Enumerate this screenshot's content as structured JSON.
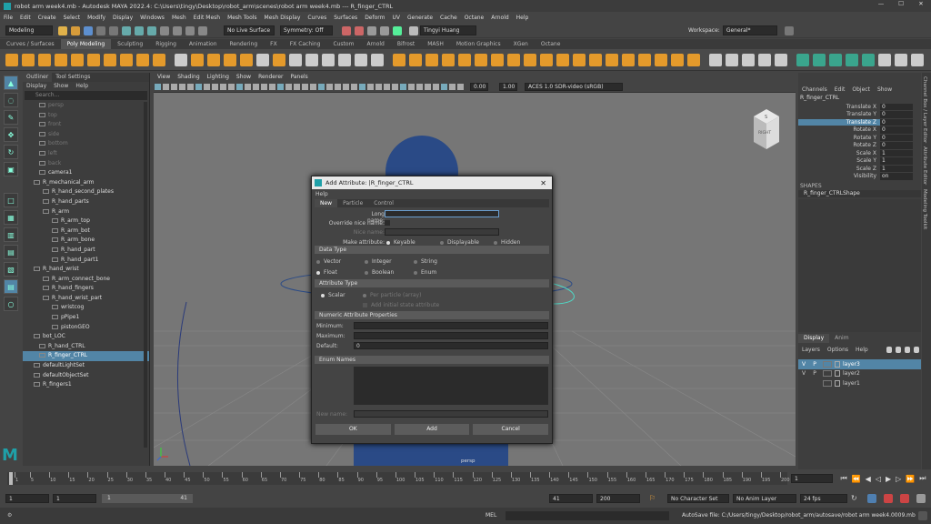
{
  "titlebar": {
    "title": "robot arm week4.mb - Autodesk MAYA 2022.4: C:\\Users\\tingy\\Desktop\\robot_arm\\scenes\\robot arm week4.mb --- R_finger_CTRL",
    "min": "—",
    "max": "☐",
    "close": "✕"
  },
  "menus": [
    "File",
    "Edit",
    "Create",
    "Select",
    "Modify",
    "Display",
    "Windows",
    "Mesh",
    "Edit Mesh",
    "Mesh Tools",
    "Mesh Display",
    "Curves",
    "Surfaces",
    "Deform",
    "UV",
    "Generate",
    "Cache",
    "Octane",
    "Arnold",
    "Help"
  ],
  "workspace": {
    "label": "Workspace:",
    "value": "General*"
  },
  "status": {
    "mode": "Modeling",
    "live": "No Live Surface",
    "symmetry": "Symmetry: Off",
    "user": "Tingyi Huang"
  },
  "shelf_tabs": [
    "Curves / Surfaces",
    "Poly Modeling",
    "Sculpting",
    "Rigging",
    "Animation",
    "Rendering",
    "FX",
    "FX Caching",
    "Custom",
    "Arnold",
    "Bifrost",
    "MASH",
    "Motion Graphics",
    "XGen",
    "Octane"
  ],
  "shelf_active": "Poly Modeling",
  "outliner": {
    "tabs": [
      "Outliner",
      "Tool Settings"
    ],
    "menu": [
      "Display",
      "Show",
      "Help"
    ],
    "search": "Search...",
    "items": [
      {
        "label": "persp",
        "indent": 18,
        "dim": true,
        "sel": false
      },
      {
        "label": "top",
        "indent": 18,
        "dim": true,
        "sel": false
      },
      {
        "label": "front",
        "indent": 18,
        "dim": true,
        "sel": false
      },
      {
        "label": "side",
        "indent": 18,
        "dim": true,
        "sel": false
      },
      {
        "label": "bottom",
        "indent": 18,
        "dim": true,
        "sel": false
      },
      {
        "label": "left",
        "indent": 18,
        "dim": true,
        "sel": false
      },
      {
        "label": "back",
        "indent": 18,
        "dim": true,
        "sel": false
      },
      {
        "label": "camera1",
        "indent": 18,
        "dim": false,
        "sel": false
      },
      {
        "label": "R_mechanical_arm",
        "indent": 12,
        "dim": false,
        "sel": false
      },
      {
        "label": "R_hand_second_plates",
        "indent": 22,
        "dim": false,
        "sel": false
      },
      {
        "label": "R_hand_parts",
        "indent": 22,
        "dim": false,
        "sel": false
      },
      {
        "label": "R_arm",
        "indent": 22,
        "dim": false,
        "sel": false
      },
      {
        "label": "R_arm_top",
        "indent": 32,
        "dim": false,
        "sel": false
      },
      {
        "label": "R_arm_bot",
        "indent": 32,
        "dim": false,
        "sel": false
      },
      {
        "label": "R_arm_bone",
        "indent": 32,
        "dim": false,
        "sel": false
      },
      {
        "label": "R_hand_part",
        "indent": 32,
        "dim": false,
        "sel": false
      },
      {
        "label": "R_hand_part1",
        "indent": 32,
        "dim": false,
        "sel": false
      },
      {
        "label": "R_hand_wrist",
        "indent": 12,
        "dim": false,
        "sel": false
      },
      {
        "label": "R_arm_connect_bone",
        "indent": 22,
        "dim": false,
        "sel": false
      },
      {
        "label": "R_hand_fingers",
        "indent": 22,
        "dim": false,
        "sel": false
      },
      {
        "label": "R_hand_wrist_part",
        "indent": 22,
        "dim": false,
        "sel": false
      },
      {
        "label": "wristcog",
        "indent": 32,
        "dim": false,
        "sel": false
      },
      {
        "label": "pPipe1",
        "indent": 32,
        "dim": false,
        "sel": false
      },
      {
        "label": "pistonGEO",
        "indent": 32,
        "dim": false,
        "sel": false
      },
      {
        "label": "bot_LOC",
        "indent": 12,
        "dim": false,
        "sel": false
      },
      {
        "label": "R_hand_CTRL",
        "indent": 18,
        "dim": false,
        "sel": false
      },
      {
        "label": "R_finger_CTRL",
        "indent": 18,
        "dim": false,
        "sel": true
      },
      {
        "label": "defaultLightSet",
        "indent": 12,
        "dim": false,
        "sel": false
      },
      {
        "label": "defaultObjectSet",
        "indent": 12,
        "dim": false,
        "sel": false
      },
      {
        "label": "R_fingers1",
        "indent": 12,
        "dim": false,
        "sel": false
      }
    ]
  },
  "viewport": {
    "menu": [
      "View",
      "Shading",
      "Lighting",
      "Show",
      "Renderer",
      "Panels"
    ],
    "exposure": "0.00",
    "gamma": "1.00",
    "colorspace": "ACES 1.0 SDR-video (sRGB)",
    "camera_label": "persp",
    "cube_top": "S",
    "cube_face": "RIGHT"
  },
  "dialog": {
    "title": "Add Attribute: |R_finger_CTRL",
    "menu": "Help",
    "tabs": [
      "New",
      "Particle",
      "Control"
    ],
    "long_name_label": "Long name:",
    "long_name_value": "",
    "override_label": "Override nice name:",
    "nice_name_label": "Nice name:",
    "make_attr_label": "Make attribute:",
    "make_attr": [
      "Keyable",
      "Displayable",
      "Hidden"
    ],
    "data_type_hdr": "Data Type",
    "data_types": [
      "Vector",
      "Integer",
      "String",
      "Float",
      "Boolean",
      "Enum"
    ],
    "attr_type_hdr": "Attribute Type",
    "attr_scalar": "Scalar",
    "attr_particle": "Per particle (array)",
    "attr_initial": "Add initial state attribute",
    "numeric_hdr": "Numeric Attribute Properties",
    "min_label": "Minimum:",
    "max_label": "Maximum:",
    "default_label": "Default:",
    "default_value": "0",
    "enum_hdr": "Enum Names",
    "new_name_label": "New name:",
    "ok": "OK",
    "add": "Add",
    "cancel": "Cancel"
  },
  "channel_box": {
    "menu": [
      "Channels",
      "Edit",
      "Object",
      "Show"
    ],
    "object": "R_finger_CTRL",
    "channels": [
      {
        "k": "Translate X",
        "v": "0"
      },
      {
        "k": "Translate Y",
        "v": "0"
      },
      {
        "k": "Translate Z",
        "v": "0"
      },
      {
        "k": "Rotate X",
        "v": "0"
      },
      {
        "k": "Rotate Y",
        "v": "0"
      },
      {
        "k": "Rotate Z",
        "v": "0"
      },
      {
        "k": "Scale X",
        "v": "1"
      },
      {
        "k": "Scale Y",
        "v": "1"
      },
      {
        "k": "Scale Z",
        "v": "1"
      },
      {
        "k": "Visibility",
        "v": "on"
      }
    ],
    "highlight": "Translate Z",
    "shapes_hdr": "SHAPES",
    "shape": "R_finger_CTRLShape"
  },
  "layers": {
    "tabs": [
      "Display",
      "Anim"
    ],
    "menu": [
      "Layers",
      "Options",
      "Help"
    ],
    "rows": [
      {
        "v": "V",
        "p": "P",
        "name": "layer3",
        "sel": true
      },
      {
        "v": "V",
        "p": "P",
        "name": "layer2",
        "sel": false
      },
      {
        "v": "",
        "p": "",
        "name": "layer1",
        "sel": false
      }
    ]
  },
  "side_tabs": [
    "Channel Box / Layer Editor",
    "Attribute Editor",
    "Modeling Toolkit"
  ],
  "timeline": {
    "ticks": [
      "1",
      "5",
      "10",
      "15",
      "20",
      "25",
      "30",
      "35",
      "40",
      "45",
      "50",
      "55",
      "60",
      "65",
      "70",
      "75",
      "80",
      "85",
      "90",
      "95",
      "100",
      "105",
      "110",
      "115",
      "120",
      "125",
      "130",
      "135",
      "140",
      "145",
      "150",
      "155",
      "160",
      "165",
      "170",
      "175",
      "180",
      "185",
      "190",
      "195",
      "200"
    ],
    "current": "1"
  },
  "range": {
    "start": "1",
    "start2": "1",
    "slider_a": "1",
    "slider_b": "41",
    "end": "41",
    "end2": "200",
    "charset": "No Character Set",
    "animlayer": "No Anim Layer",
    "fps": "24 fps"
  },
  "cmd": {
    "lang": "MEL",
    "status": "AutoSave file: C:/Users/tingy/Desktop/robot_arm/autosave/robot arm week4.0009.mb"
  },
  "colors": {
    "accent": "#5285a6",
    "robot": "#2a4a86",
    "dialog_title": "#e8e8e8"
  }
}
